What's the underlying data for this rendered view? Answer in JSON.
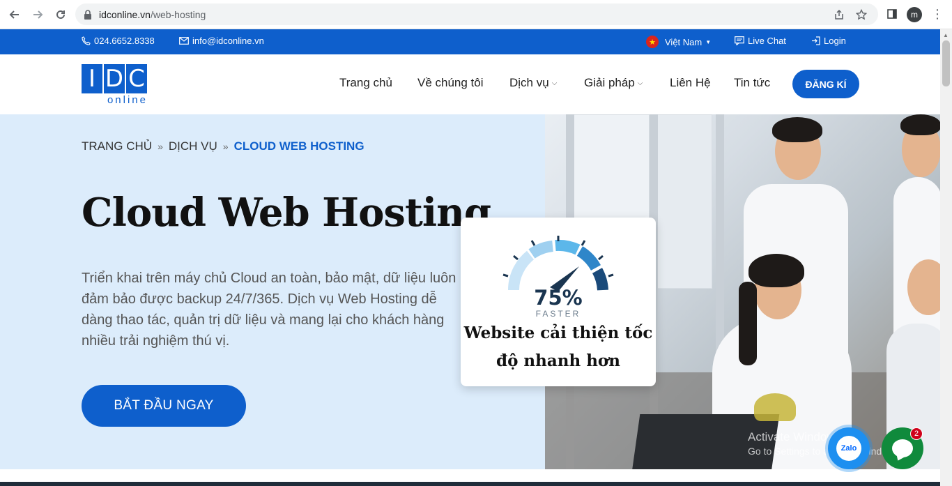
{
  "browser": {
    "url_host": "idconline.vn",
    "url_path": "/web-hosting",
    "profile_initial": "m"
  },
  "topbar": {
    "phone": "024.6652.8338",
    "email": "info@idconline.vn",
    "language": "Việt Nam",
    "live_chat": "Live Chat",
    "login": "Login"
  },
  "header": {
    "logo_letters": [
      "I",
      "D",
      "C"
    ],
    "logo_sub": "online",
    "menu": [
      {
        "label": "Trang chủ",
        "dropdown": false
      },
      {
        "label": "Về chúng tôi",
        "dropdown": false
      },
      {
        "label": "Dịch vụ",
        "dropdown": true
      },
      {
        "label": "Giải pháp",
        "dropdown": true
      },
      {
        "label": "Liên Hệ",
        "dropdown": false
      },
      {
        "label": "Tin tức",
        "dropdown": false
      }
    ],
    "register_label": "ĐĂNG KÍ"
  },
  "hero": {
    "breadcrumb": [
      "TRANG CHỦ",
      "DỊCH VỤ",
      "CLOUD WEB HOSTING"
    ],
    "title": "Cloud Web Hosting",
    "description": "Triển khai trên máy chủ Cloud an toàn, bảo mật, dữ liệu luôn đảm bảo được backup 24/7/365. Dịch vụ Web Hosting dễ dàng thao tác, quản trị dữ liệu và mang lại cho khách hàng nhiều trải nghiệm thú vị.",
    "cta_label": "BẮT ĐẦU NGAY"
  },
  "speed_card": {
    "percent": "75%",
    "faster": "FASTER",
    "caption": "Website cải thiện tốc độ nhanh hơn"
  },
  "watermark": {
    "title": "Activate Windows",
    "subtitle": "Go to Settings to activate Windows."
  },
  "chat": {
    "zalo_label": "Zalo",
    "badge_count": "2"
  },
  "colors": {
    "brand_blue": "#0e5fcc",
    "hero_bg": "#dcecfb",
    "chat_green": "#108a3c"
  }
}
